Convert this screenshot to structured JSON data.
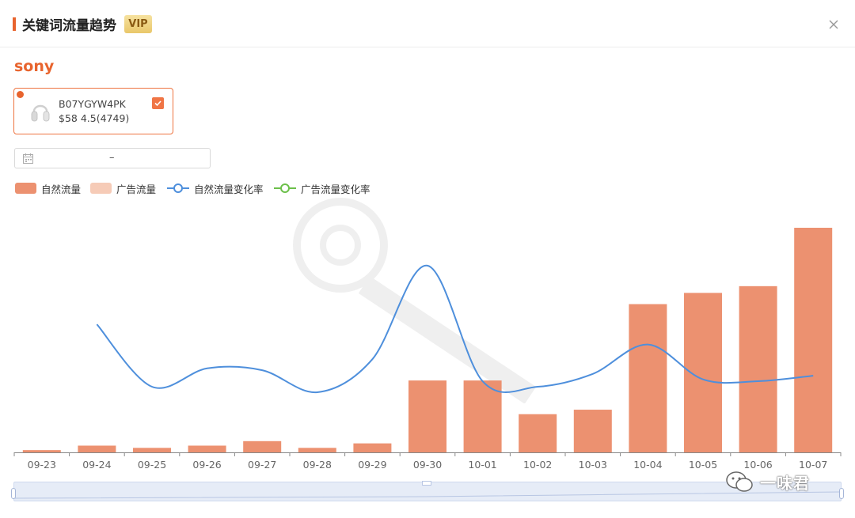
{
  "header": {
    "title": "关键词流量趋势",
    "vip_badge": "VIP"
  },
  "keyword": "sony",
  "product": {
    "asin": "B07YGYW4PK",
    "price_rating": "$58 4.5(4749)",
    "selected": true
  },
  "date_range": {
    "separator": "–"
  },
  "legend": [
    {
      "label": "自然流量",
      "color": "#ec9170",
      "kind": "bar"
    },
    {
      "label": "广告流量",
      "color": "#f6cbb7",
      "kind": "bar"
    },
    {
      "label": "自然流量变化率",
      "color": "#4e8fdc",
      "kind": "line"
    },
    {
      "label": "广告流量变化率",
      "color": "#6cc04a",
      "kind": "line"
    }
  ],
  "colors": {
    "accent": "#e8642e",
    "organic_bar": "#ec9170",
    "ad_bar": "#f6cbb7",
    "organic_line": "#4e8fdc",
    "ad_line": "#6cc04a"
  },
  "chart_data": {
    "type": "bar",
    "categories": [
      "09-23",
      "09-24",
      "09-25",
      "09-26",
      "09-27",
      "09-28",
      "09-29",
      "09-30",
      "10-01",
      "10-02",
      "10-03",
      "10-04",
      "10-05",
      "10-06",
      "10-07"
    ],
    "series": [
      {
        "name": "自然流量",
        "type": "bar",
        "values": [
          1,
          3,
          2,
          3,
          5,
          2,
          4,
          32,
          32,
          17,
          19,
          66,
          71,
          74,
          100
        ]
      },
      {
        "name": "自然流量变化率",
        "type": "line",
        "values": [
          null,
          59,
          25,
          35,
          34,
          22,
          40,
          91,
          28,
          25,
          32,
          48,
          29,
          28,
          31
        ]
      }
    ],
    "xlabel": "",
    "ylabel": "",
    "grid": false
  },
  "brand": {
    "text": "一味君",
    "icon": "wechat-icon"
  },
  "icons": {
    "close": "close-icon",
    "calendar": "calendar-icon",
    "checkbox": "checkmark-icon",
    "product": "headphones-icon"
  }
}
